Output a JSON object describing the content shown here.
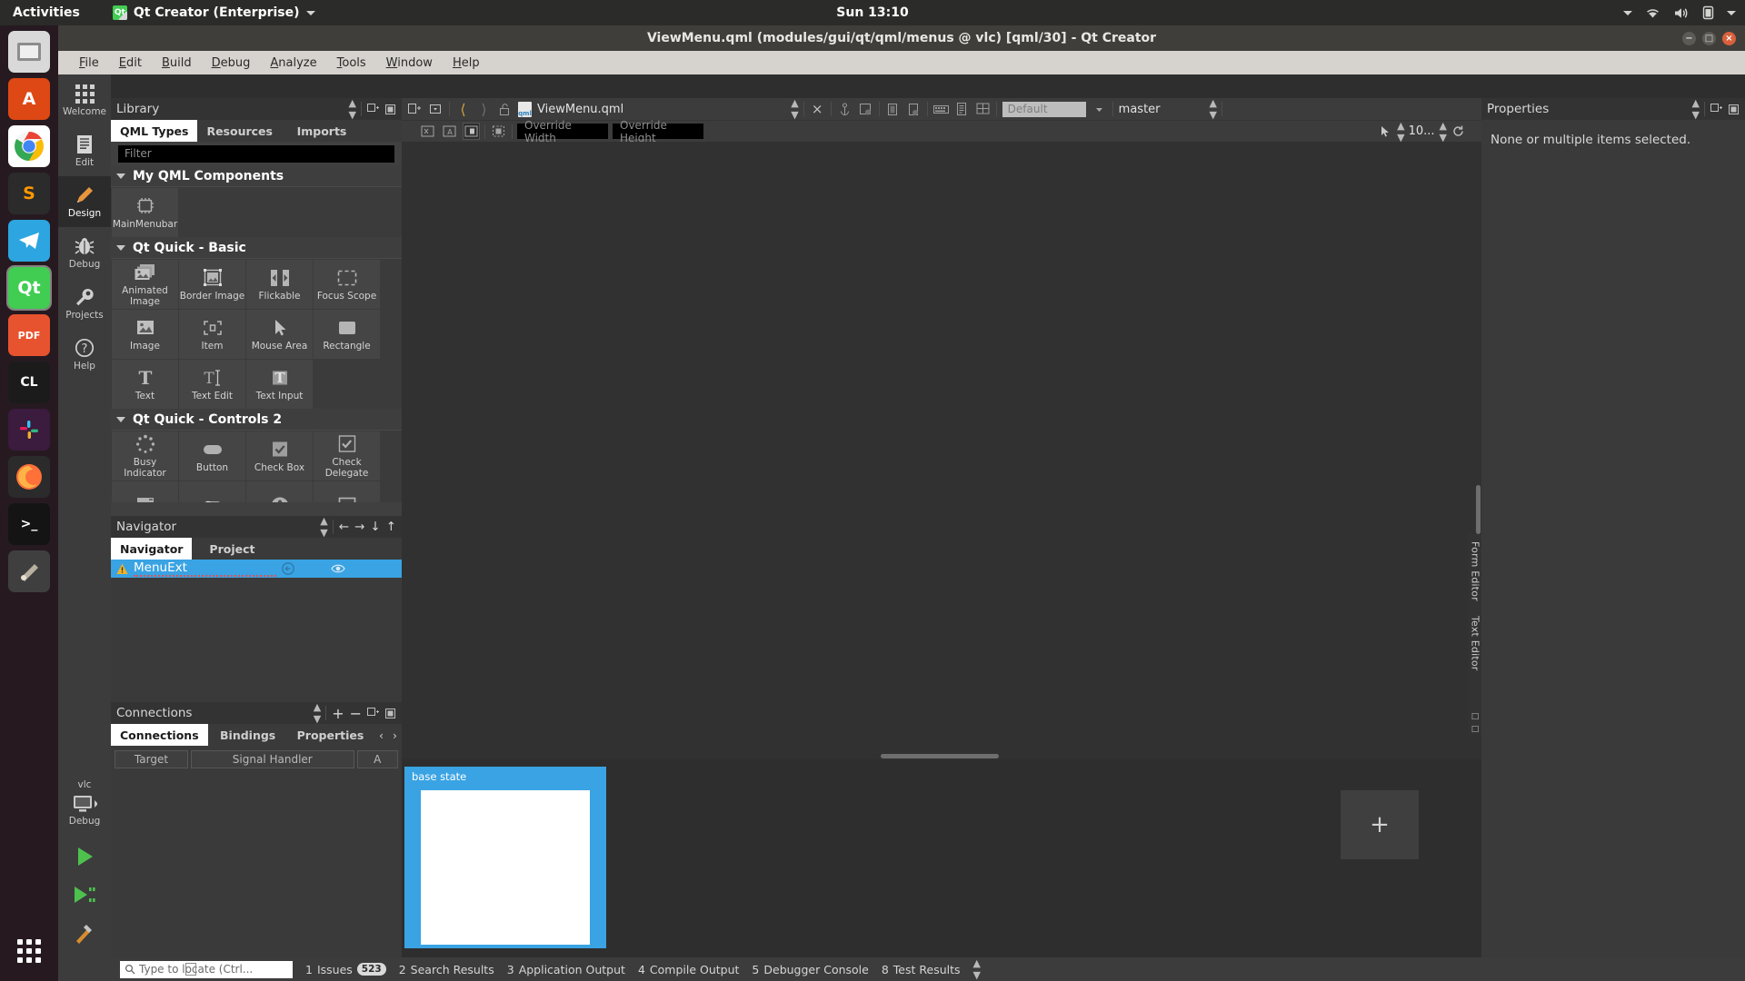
{
  "gnome": {
    "activities": "Activities",
    "app_name": "Qt Creator (Enterprise)",
    "app_icon": "qt-logo-icon",
    "clock": "Sun 13:10",
    "indicators": [
      "chevron-down-icon",
      "wifi-icon",
      "volume-icon",
      "battery-icon",
      "chevron-down-icon"
    ]
  },
  "dock": {
    "items": [
      {
        "name": "files-icon",
        "glyph": "▤",
        "color": "#4b4b4b",
        "text": ""
      },
      {
        "name": "ubuntu-software-icon",
        "glyph": "A",
        "color": "#dd4814",
        "text": "A"
      },
      {
        "name": "chrome-icon",
        "glyph": "",
        "color": "#ffffff",
        "text": ""
      },
      {
        "name": "sublime-text-icon",
        "glyph": "S",
        "color": "#2b2b2b",
        "text": "S"
      },
      {
        "name": "telegram-icon",
        "glyph": "➤",
        "color": "#2ca5e0",
        "text": ""
      },
      {
        "name": "qt-creator-icon",
        "glyph": "Qt",
        "color": "#41cd52",
        "text": "Qt"
      },
      {
        "name": "pdf-viewer-icon",
        "glyph": "PDF",
        "color": "#e8532f",
        "text": "PDF"
      },
      {
        "name": "clion-icon",
        "glyph": "CL",
        "color": "#1b1b1b",
        "text": "CL"
      },
      {
        "name": "slack-icon",
        "glyph": "#",
        "color": "#4a154b",
        "text": ""
      },
      {
        "name": "firefox-icon",
        "glyph": "",
        "color": "#2b2b2b",
        "text": ""
      },
      {
        "name": "terminal-icon",
        "glyph": ">_",
        "color": "#1b1b1b",
        "text": ">_"
      },
      {
        "name": "gimp-icon",
        "glyph": "",
        "color": "#3a3a3a",
        "text": ""
      }
    ],
    "app_grid": "show-applications-icon"
  },
  "window": {
    "title": "ViewMenu.qml (modules/gui/qt/qml/menus @ vlc) [qml/30] - Qt Creator",
    "buttons": [
      "minimize-button",
      "maximize-button",
      "close-button"
    ]
  },
  "menubar": {
    "items": [
      "File",
      "Edit",
      "Build",
      "Debug",
      "Analyze",
      "Tools",
      "Window",
      "Help"
    ]
  },
  "modes": {
    "items": [
      {
        "label": "Welcome",
        "icon": "grid-icon",
        "active": false
      },
      {
        "label": "Edit",
        "icon": "document-icon",
        "active": false
      },
      {
        "label": "Design",
        "icon": "pencil-icon",
        "active": true
      },
      {
        "label": "Debug",
        "icon": "bug-icon",
        "active": false
      },
      {
        "label": "Projects",
        "icon": "wrench-icon",
        "active": false
      },
      {
        "label": "Help",
        "icon": "question-icon",
        "active": false
      }
    ],
    "kit": {
      "project": "vlc",
      "build_config": "Debug",
      "icon": "computer-icon"
    },
    "run_buttons": [
      "run-button",
      "debug-run-button",
      "build-button"
    ]
  },
  "library": {
    "title": "Library",
    "tabs": [
      {
        "label": "QML Types",
        "active": true
      },
      {
        "label": "Resources",
        "active": false
      },
      {
        "label": "Imports",
        "active": false
      }
    ],
    "filter_placeholder": "Filter",
    "filter_value": "",
    "groups": [
      {
        "name": "My QML Components",
        "items": [
          {
            "label": "MainMenubar",
            "icon": "chip-icon"
          }
        ]
      },
      {
        "name": "Qt Quick - Basic",
        "items": [
          {
            "label": "Animated Image",
            "icon": "animated-image-icon"
          },
          {
            "label": "Border Image",
            "icon": "border-image-icon"
          },
          {
            "label": "Flickable",
            "icon": "flickable-icon"
          },
          {
            "label": "Focus Scope",
            "icon": "focus-scope-icon"
          },
          {
            "label": "Image",
            "icon": "image-icon"
          },
          {
            "label": "Item",
            "icon": "item-icon"
          },
          {
            "label": "Mouse Area",
            "icon": "cursor-icon"
          },
          {
            "label": "Rectangle",
            "icon": "rectangle-icon"
          },
          {
            "label": "Text",
            "icon": "text-icon"
          },
          {
            "label": "Text Edit",
            "icon": "text-edit-icon"
          },
          {
            "label": "Text Input",
            "icon": "text-input-icon"
          }
        ]
      },
      {
        "name": "Qt Quick - Controls 2",
        "items": [
          {
            "label": "Busy Indicator",
            "icon": "busy-indicator-icon"
          },
          {
            "label": "Button",
            "icon": "button-icon"
          },
          {
            "label": "Check Box",
            "icon": "check-box-icon"
          },
          {
            "label": "Check Delegate",
            "icon": "check-delegate-icon"
          },
          {
            "label": "",
            "icon": "combo-box-icon"
          },
          {
            "label": "",
            "icon": "switch-icon"
          },
          {
            "label": "",
            "icon": "dial-icon"
          },
          {
            "label": "",
            "icon": "frame-icon"
          }
        ]
      }
    ]
  },
  "navigator": {
    "title": "Navigator",
    "toolbar_icons": [
      "arrow-left-icon",
      "arrow-right-icon",
      "arrow-down-icon",
      "arrow-up-icon"
    ],
    "tabs": [
      {
        "label": "Navigator",
        "active": true
      },
      {
        "label": "Project",
        "active": false
      }
    ],
    "rows": [
      {
        "label": "MenuExt",
        "warning": true,
        "export_icon": "export-icon",
        "visible_icon": "eye-icon",
        "selected": true
      }
    ]
  },
  "connections": {
    "title": "Connections",
    "toolbar_icons": [
      "plus-icon",
      "minus-icon",
      "expand-icon",
      "collapse-icon"
    ],
    "tabs": [
      {
        "label": "Connections",
        "active": true
      },
      {
        "label": "Bindings",
        "active": false
      },
      {
        "label": "Properties",
        "active": false
      }
    ],
    "nav_icons": [
      "chevron-left-icon",
      "chevron-right-icon"
    ],
    "columns": [
      "Target",
      "Signal Handler",
      "A"
    ]
  },
  "editor": {
    "toolbar": {
      "split_icons": [
        "split-icon",
        "split-dropdown-icon"
      ],
      "nav_back": "chevron-left-icon",
      "nav_forward": "chevron-right-icon",
      "lock": "unlock-icon",
      "file_icon": "qml-file-icon",
      "file_name": "ViewMenu.qml",
      "selector": "updown-icon",
      "close": "close-icon",
      "right_icons": [
        "anchor-icon",
        "crop-icon",
        "device-icon",
        "device-sync-icon",
        "keyboard-icon",
        "list-icon",
        "grid-icon"
      ],
      "style_combo": "Default",
      "branch": "master"
    },
    "design_toolbar": {
      "icons": [
        "no-snapping-icon",
        "snap-anchors-icon",
        "snap-items-icon",
        "select-only-icon"
      ],
      "override_width_placeholder": "Override Width",
      "override_height_placeholder": "Override Height",
      "zoom_value": "10...",
      "zoom_icons": [
        "select-tool-icon",
        "zoom-stepper-icon",
        "reset-view-icon"
      ]
    }
  },
  "states": {
    "cards": [
      {
        "label": "base state",
        "selected": true
      }
    ],
    "add_label": "+"
  },
  "properties": {
    "title": "Properties",
    "empty_message": "None or multiple items selected.",
    "toolbar_icons": [
      "updown-icon",
      "expand-icon",
      "collapse-icon"
    ]
  },
  "side_tabs": [
    {
      "label": "Form Editor"
    },
    {
      "label": "Text Editor"
    }
  ],
  "statusbar": {
    "toggle_icon": "sidebar-toggle-icon",
    "locator_placeholder": "Type to locate (Ctrl...",
    "locator_icon": "search-icon",
    "items": [
      {
        "num": "1",
        "label": "Issues",
        "badge": "523"
      },
      {
        "num": "2",
        "label": "Search Results",
        "badge": ""
      },
      {
        "num": "3",
        "label": "Application Output",
        "badge": ""
      },
      {
        "num": "4",
        "label": "Compile Output",
        "badge": ""
      },
      {
        "num": "5",
        "label": "Debugger Console",
        "badge": ""
      },
      {
        "num": "8",
        "label": "Test Results",
        "badge": ""
      }
    ],
    "more_icon": "updown-icon"
  },
  "colors": {
    "accent": "#3aa3e3",
    "qt_green": "#41cd52",
    "panel": "#3a3a3a",
    "canvas": "#313131",
    "menubar": "#d6d2cd"
  }
}
